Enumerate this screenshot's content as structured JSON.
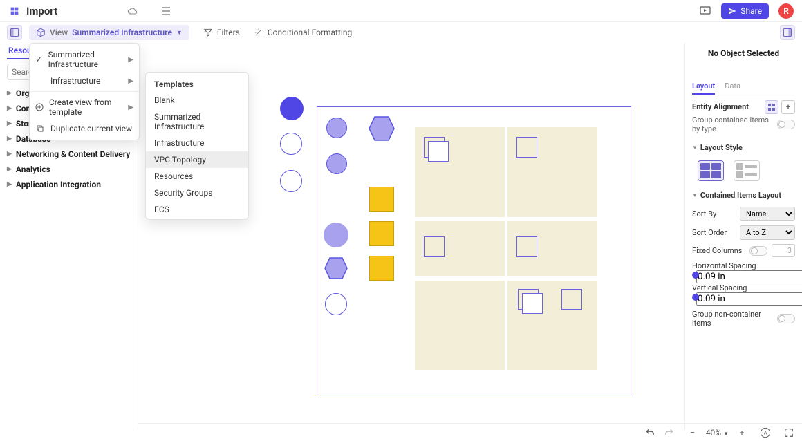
{
  "header": {
    "title": "Import",
    "share_label": "Share",
    "avatar_initial": "R"
  },
  "toolbar": {
    "view_label": "View",
    "current_view": "Summarized Infrastructure",
    "filters_label": "Filters",
    "cond_format_label": "Conditional Formatting"
  },
  "view_menu": {
    "items": [
      {
        "label": "Summarized Infrastructure",
        "icon": "check",
        "submenu": true
      },
      {
        "label": "Infrastructure",
        "icon": "",
        "submenu": true
      }
    ],
    "create_from_template": "Create view from template",
    "duplicate": "Duplicate current view"
  },
  "templates_menu": {
    "header": "Templates",
    "items": [
      "Blank",
      "Summarized Infrastructure",
      "Infrastructure",
      "VPC Topology",
      "Resources",
      "Security Groups",
      "ECS"
    ],
    "highlighted": "VPC Topology"
  },
  "sidebar": {
    "tab": "Resources",
    "search_placeholder": "Search",
    "categories": [
      "Organization",
      "Compute",
      "Storage",
      "Database",
      "Networking & Content Delivery",
      "Analytics",
      "Application Integration"
    ]
  },
  "rightpanel": {
    "no_object": "No Object Selected",
    "tabs": {
      "layout": "Layout",
      "data": "Data"
    },
    "entity_alignment": "Entity Alignment",
    "group_by_type": "Group contained items by type",
    "layout_style": "Layout Style",
    "contained_layout": "Contained Items Layout",
    "sort_by_label": "Sort By",
    "sort_by_value": "Name",
    "sort_order_label": "Sort Order",
    "sort_order_value": "A to Z",
    "fixed_columns_label": "Fixed Columns",
    "fixed_columns_value": "3",
    "horizontal_spacing_label": "Horizontal Spacing",
    "horizontal_spacing_value": "0.09 in",
    "vertical_spacing_label": "Vertical Spacing",
    "vertical_spacing_value": "0.09 in",
    "group_non_container": "Group non-container items"
  },
  "bottombar": {
    "zoom": "40%"
  }
}
